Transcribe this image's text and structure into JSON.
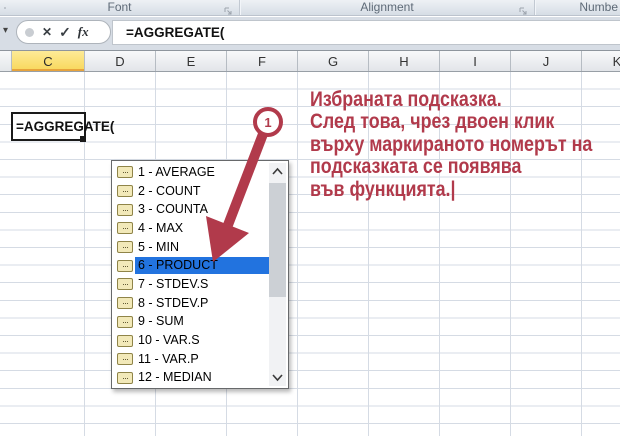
{
  "colors": {
    "accent": "#b13a4b",
    "selection": "#2273df",
    "grid": "#d5dbe4",
    "icon-bg": "#f2e9b9",
    "icon-border": "#8f8448"
  },
  "ribbon": {
    "groups": [
      {
        "label": "Font"
      },
      {
        "label": "Alignment"
      },
      {
        "label": "Numbe"
      }
    ]
  },
  "formula_bar": {
    "namebox_arrow": "▾",
    "cancel_icon": "✕",
    "enter_icon": "✓",
    "fx_label": "fx",
    "formula": "=AGGREGATE("
  },
  "sheet": {
    "columns": [
      "C",
      "D",
      "E",
      "F",
      "G",
      "H",
      "I",
      "J",
      "K"
    ],
    "selected_column": "C",
    "active_cell_formula": "=AGGREGATE("
  },
  "autocomplete": {
    "icon_dots": "···",
    "items": [
      {
        "label": "1 - AVERAGE",
        "selected": false
      },
      {
        "label": "2 - COUNT",
        "selected": false
      },
      {
        "label": "3 - COUNTA",
        "selected": false
      },
      {
        "label": "4 - MAX",
        "selected": false
      },
      {
        "label": "5 - MIN",
        "selected": false
      },
      {
        "label": "6 - PRODUCT",
        "selected": true
      },
      {
        "label": "7 - STDEV.S",
        "selected": false
      },
      {
        "label": "8 - STDEV.P",
        "selected": false
      },
      {
        "label": "9 - SUM",
        "selected": false
      },
      {
        "label": "10 - VAR.S",
        "selected": false
      },
      {
        "label": "11 - VAR.P",
        "selected": false
      },
      {
        "label": "12 - MEDIAN",
        "selected": false
      }
    ]
  },
  "annotation": {
    "callout_number": "1",
    "lines": [
      "Избраната подсказка.",
      "След това, чрез двоен клик",
      "върху маркираното номерът на",
      "подсказката се появява",
      "във функцията.|"
    ]
  }
}
